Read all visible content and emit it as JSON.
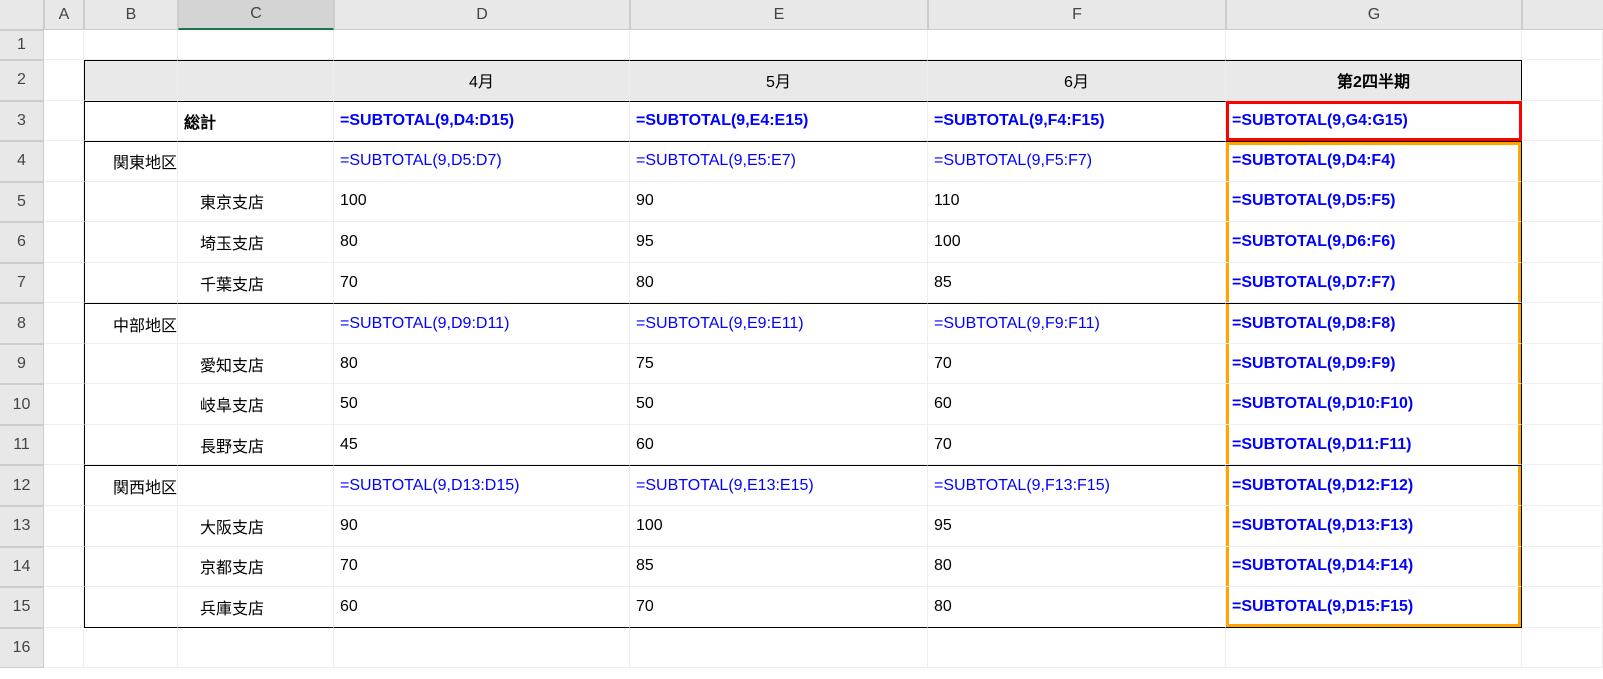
{
  "columns": [
    "A",
    "B",
    "C",
    "D",
    "E",
    "F",
    "G"
  ],
  "row_numbers": [
    1,
    2,
    3,
    4,
    5,
    6,
    7,
    8,
    9,
    10,
    11,
    12,
    13,
    14,
    15,
    16
  ],
  "selected_column": "C",
  "header": {
    "d": "4月",
    "e": "5月",
    "f": "6月",
    "g": "第2四半期"
  },
  "total_label": "総計",
  "regions": [
    {
      "name": "関東地区",
      "branches": [
        "東京支店",
        "埼玉支店",
        "千葉支店"
      ]
    },
    {
      "name": "中部地区",
      "branches": [
        "愛知支店",
        "岐阜支店",
        "長野支店"
      ]
    },
    {
      "name": "関西地区",
      "branches": [
        "大阪支店",
        "京都支店",
        "兵庫支店"
      ]
    }
  ],
  "numbers": {
    "r5": {
      "d": "100",
      "e": "90",
      "f": "110"
    },
    "r6": {
      "d": "80",
      "e": "95",
      "f": "100"
    },
    "r7": {
      "d": "70",
      "e": "80",
      "f": "85"
    },
    "r9": {
      "d": "80",
      "e": "75",
      "f": "70"
    },
    "r10": {
      "d": "50",
      "e": "50",
      "f": "60"
    },
    "r11": {
      "d": "45",
      "e": "60",
      "f": "70"
    },
    "r13": {
      "d": "90",
      "e": "100",
      "f": "95"
    },
    "r14": {
      "d": "70",
      "e": "85",
      "f": "80"
    },
    "r15": {
      "d": "60",
      "e": "70",
      "f": "80"
    }
  },
  "formulas": {
    "r3": {
      "d": "=SUBTOTAL(9,D4:D15)",
      "e": "=SUBTOTAL(9,E4:E15)",
      "f": "=SUBTOTAL(9,F4:F15)",
      "g": "=SUBTOTAL(9,G4:G15)"
    },
    "r4": {
      "d": "=SUBTOTAL(9,D5:D7)",
      "e": "=SUBTOTAL(9,E5:E7)",
      "f": "=SUBTOTAL(9,F5:F7)",
      "g": "=SUBTOTAL(9,D4:F4)"
    },
    "r5g": "=SUBTOTAL(9,D5:F5)",
    "r6g": "=SUBTOTAL(9,D6:F6)",
    "r7g": "=SUBTOTAL(9,D7:F7)",
    "r8": {
      "d": "=SUBTOTAL(9,D9:D11)",
      "e": "=SUBTOTAL(9,E9:E11)",
      "f": "=SUBTOTAL(9,F9:F11)",
      "g": "=SUBTOTAL(9,D8:F8)"
    },
    "r9g": "=SUBTOTAL(9,D9:F9)",
    "r10g": "=SUBTOTAL(9,D10:F10)",
    "r11g": "=SUBTOTAL(9,D11:F11)",
    "r12": {
      "d": "=SUBTOTAL(9,D13:D15)",
      "e": "=SUBTOTAL(9,E13:E15)",
      "f": "=SUBTOTAL(9,F13:F15)",
      "g": "=SUBTOTAL(9,D12:F12)"
    },
    "r13g": "=SUBTOTAL(9,D13:F13)",
    "r14g": "=SUBTOTAL(9,D14:F14)",
    "r15g": "=SUBTOTAL(9,D15:F15)"
  }
}
